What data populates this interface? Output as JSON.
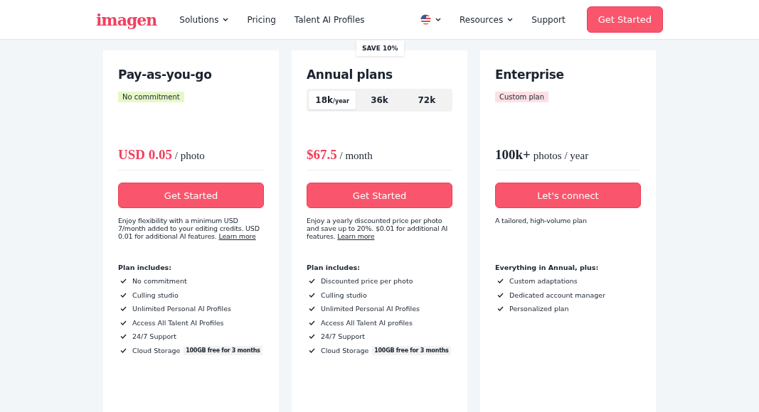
{
  "header": {
    "logo": "imagen",
    "nav_left": [
      {
        "label": "Solutions",
        "dropdown": true
      },
      {
        "label": "Pricing",
        "dropdown": false
      },
      {
        "label": "Talent AI Profiles",
        "dropdown": false
      }
    ],
    "nav_right": [
      {
        "label": "Resources",
        "dropdown": true
      },
      {
        "label": "Support",
        "dropdown": false
      }
    ],
    "cta": "Get Started"
  },
  "plans": [
    {
      "name": "Pay-as-you-go",
      "tag": {
        "label": "No commitment",
        "color": "#e6f8c8"
      },
      "price": {
        "amount": "USD 0.05",
        "unit": "/ photo",
        "highlight": true
      },
      "button": "Get Started",
      "description": "Enjoy flexibility with a minimum USD 7/month added to your editing credits. USD 0.01 for additional AI features.",
      "link": "Learn more",
      "features_title": "Plan includes:",
      "features": [
        {
          "text": "No commitment"
        },
        {
          "text": "Culling studio"
        },
        {
          "text": "Unlimited Personal AI Profiles"
        },
        {
          "text": "Access All Talent AI Profiles"
        },
        {
          "text": "24/7 Support"
        },
        {
          "text": "Cloud Storage",
          "note": "100GB free for 3 months"
        }
      ]
    },
    {
      "name": "Annual plans",
      "badge": "SAVE 10%",
      "options": [
        {
          "label": "18k",
          "suffix": "/year",
          "selected": true
        },
        {
          "label": "36k",
          "selected": false
        },
        {
          "label": "72k",
          "selected": false
        }
      ],
      "price": {
        "amount": "$67.5",
        "unit": "/ month",
        "highlight": true
      },
      "button": "Get Started",
      "description": "Enjoy a yearly discounted price per photo and save up to 20%. $0.01 for additional AI features.",
      "link": "Learn more",
      "features_title": "Plan includes:",
      "features": [
        {
          "text": "Discounted price per photo"
        },
        {
          "text": "Culling studio"
        },
        {
          "text": "Unlimited Personal AI Profiles"
        },
        {
          "text": "Access All Talent AI profiles"
        },
        {
          "text": "24/7 Support"
        },
        {
          "text": "Cloud Storage",
          "note": "100GB free for 3 months"
        }
      ]
    },
    {
      "name": "Enterprise",
      "tag": {
        "label": "Custom plan",
        "color": "#fde0e4"
      },
      "price": {
        "amount": "100k+",
        "unit": "photos / year",
        "highlight": false
      },
      "button": "Let's connect",
      "description": "A tailored, high-volume plan",
      "features_title": "Everything in Annual, plus:",
      "features": [
        {
          "text": "Custom adaptations"
        },
        {
          "text": "Dedicated account manager"
        },
        {
          "text": "Personalized plan"
        }
      ]
    }
  ]
}
